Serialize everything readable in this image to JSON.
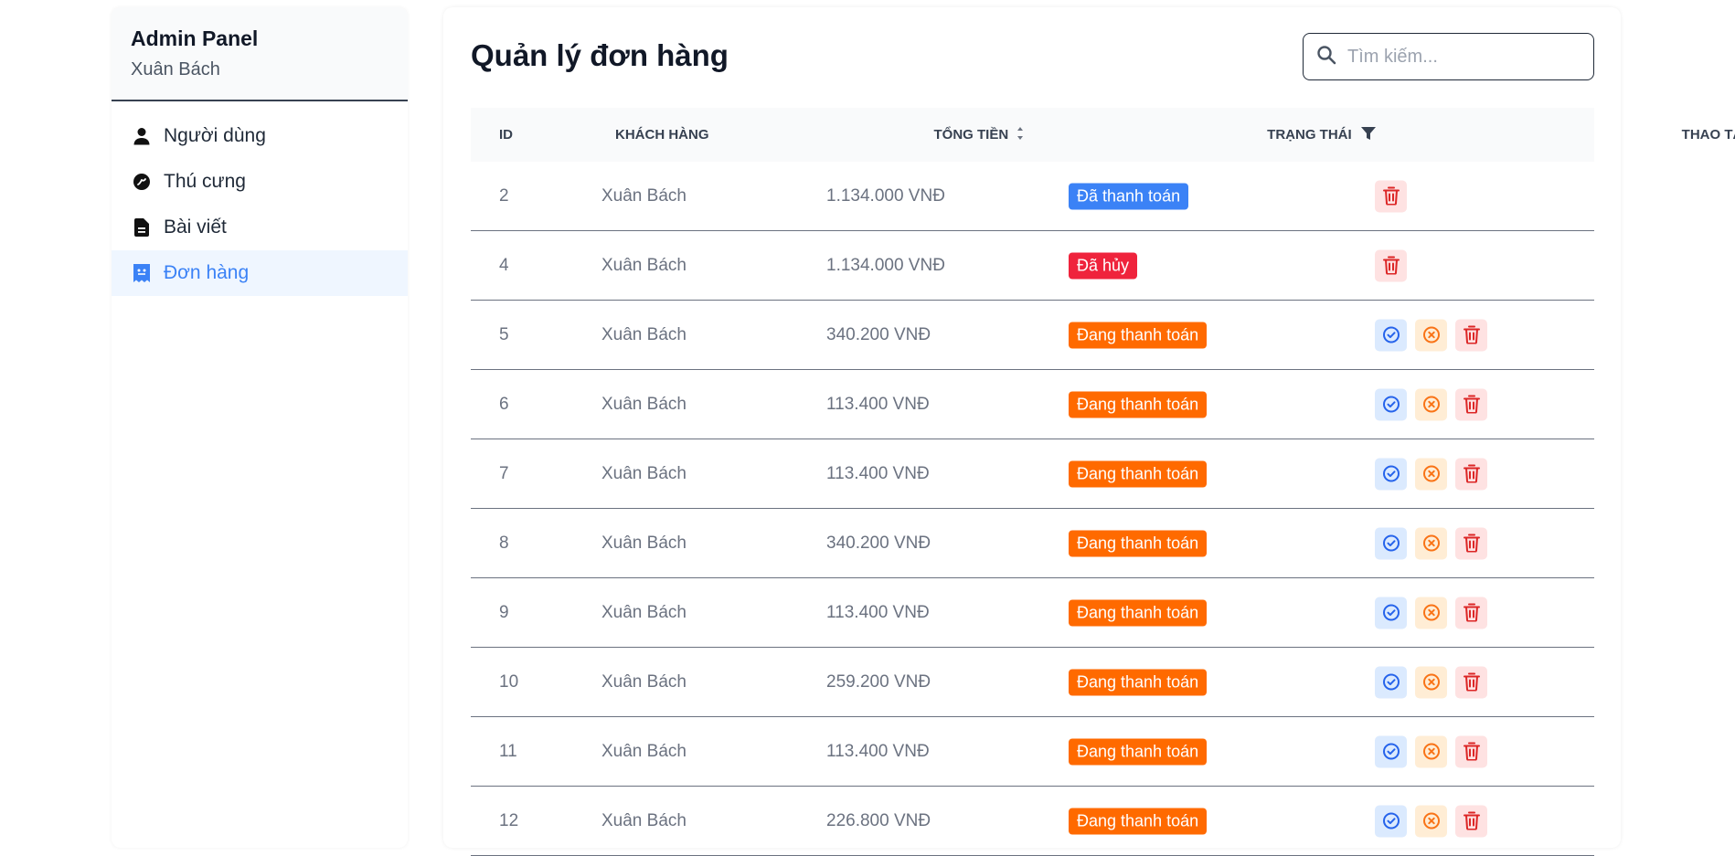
{
  "sidebar": {
    "title": "Admin Panel",
    "user": "Xuân Bách",
    "items": [
      {
        "label": "Người dùng",
        "icon": "user-icon",
        "active": false
      },
      {
        "label": "Thú cưng",
        "icon": "pet-icon",
        "active": false
      },
      {
        "label": "Bài viết",
        "icon": "document-icon",
        "active": false
      },
      {
        "label": "Đơn hàng",
        "icon": "receipt-icon",
        "active": true
      }
    ]
  },
  "main": {
    "title": "Quản lý đơn hàng",
    "search": {
      "placeholder": "Tìm kiếm...",
      "value": ""
    }
  },
  "table": {
    "headers": {
      "id": "ID",
      "customer": "KHÁCH HÀNG",
      "total": "TỔNG TIỀN",
      "status": "TRẠNG THÁI",
      "actions": "THAO TÁC"
    },
    "rows": [
      {
        "id": "2",
        "customer": "Xuân Bách",
        "total": "1.134.000 VNĐ",
        "status": "Đã thanh toán",
        "status_type": "paid",
        "actions": [
          "delete"
        ]
      },
      {
        "id": "4",
        "customer": "Xuân Bách",
        "total": "1.134.000 VNĐ",
        "status": "Đã hủy",
        "status_type": "cancelled",
        "actions": [
          "delete"
        ]
      },
      {
        "id": "5",
        "customer": "Xuân Bách",
        "total": "340.200 VNĐ",
        "status": "Đang thanh toán",
        "status_type": "pending",
        "actions": [
          "confirm",
          "cancel",
          "delete"
        ]
      },
      {
        "id": "6",
        "customer": "Xuân Bách",
        "total": "113.400 VNĐ",
        "status": "Đang thanh toán",
        "status_type": "pending",
        "actions": [
          "confirm",
          "cancel",
          "delete"
        ]
      },
      {
        "id": "7",
        "customer": "Xuân Bách",
        "total": "113.400 VNĐ",
        "status": "Đang thanh toán",
        "status_type": "pending",
        "actions": [
          "confirm",
          "cancel",
          "delete"
        ]
      },
      {
        "id": "8",
        "customer": "Xuân Bách",
        "total": "340.200 VNĐ",
        "status": "Đang thanh toán",
        "status_type": "pending",
        "actions": [
          "confirm",
          "cancel",
          "delete"
        ]
      },
      {
        "id": "9",
        "customer": "Xuân Bách",
        "total": "113.400 VNĐ",
        "status": "Đang thanh toán",
        "status_type": "pending",
        "actions": [
          "confirm",
          "cancel",
          "delete"
        ]
      },
      {
        "id": "10",
        "customer": "Xuân Bách",
        "total": "259.200 VNĐ",
        "status": "Đang thanh toán",
        "status_type": "pending",
        "actions": [
          "confirm",
          "cancel",
          "delete"
        ]
      },
      {
        "id": "11",
        "customer": "Xuân Bách",
        "total": "113.400 VNĐ",
        "status": "Đang thanh toán",
        "status_type": "pending",
        "actions": [
          "confirm",
          "cancel",
          "delete"
        ]
      },
      {
        "id": "12",
        "customer": "Xuân Bách",
        "total": "226.800 VNĐ",
        "status": "Đang thanh toán",
        "status_type": "pending",
        "actions": [
          "confirm",
          "cancel",
          "delete"
        ]
      }
    ]
  },
  "colors": {
    "accent": "#3b82f6",
    "paid": "#3b82f6",
    "cancelled": "#ef233c",
    "pending": "#ff6a00",
    "confirm_icon": "#2563eb",
    "cancel_icon": "#f97316",
    "delete_icon": "#dc2626"
  }
}
